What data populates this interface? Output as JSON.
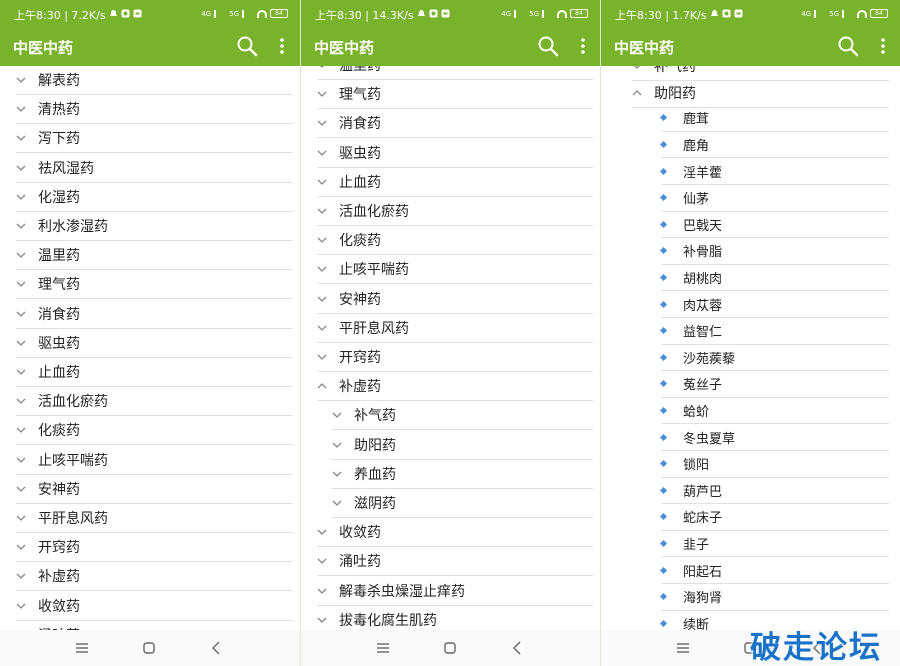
{
  "app_title": "中医中药",
  "watermark": "破走论坛",
  "colors": {
    "primary": "#79b22b",
    "leaf_bullet": "#4a90d9",
    "watermark": "#1a73c9"
  },
  "panels": [
    {
      "status": {
        "time": "上午8:30",
        "speed": "7.2K/s",
        "net1": "4G",
        "net2": "5G",
        "battery": "84"
      },
      "rows": [
        {
          "label": "解表药",
          "level": 0,
          "expanded": false
        },
        {
          "label": "清热药",
          "level": 0,
          "expanded": false
        },
        {
          "label": "泻下药",
          "level": 0,
          "expanded": false
        },
        {
          "label": "祛风湿药",
          "level": 0,
          "expanded": false
        },
        {
          "label": "化湿药",
          "level": 0,
          "expanded": false
        },
        {
          "label": "利水渗湿药",
          "level": 0,
          "expanded": false
        },
        {
          "label": "温里药",
          "level": 0,
          "expanded": false
        },
        {
          "label": "理气药",
          "level": 0,
          "expanded": false
        },
        {
          "label": "消食药",
          "level": 0,
          "expanded": false
        },
        {
          "label": "驱虫药",
          "level": 0,
          "expanded": false
        },
        {
          "label": "止血药",
          "level": 0,
          "expanded": false
        },
        {
          "label": "活血化瘀药",
          "level": 0,
          "expanded": false
        },
        {
          "label": "化痰药",
          "level": 0,
          "expanded": false
        },
        {
          "label": "止咳平喘药",
          "level": 0,
          "expanded": false
        },
        {
          "label": "安神药",
          "level": 0,
          "expanded": false
        },
        {
          "label": "平肝息风药",
          "level": 0,
          "expanded": false
        },
        {
          "label": "开窍药",
          "level": 0,
          "expanded": false
        },
        {
          "label": "补虚药",
          "level": 0,
          "expanded": false
        },
        {
          "label": "收敛药",
          "level": 0,
          "expanded": false
        },
        {
          "label": "涌吐药",
          "level": 0,
          "expanded": false
        }
      ]
    },
    {
      "status": {
        "time": "上午8:30",
        "speed": "14.3K/s",
        "net1": "4G",
        "net2": "5G",
        "battery": "84"
      },
      "rows": [
        {
          "label": "温里药",
          "level": 0,
          "expanded": false
        },
        {
          "label": "理气药",
          "level": 0,
          "expanded": false
        },
        {
          "label": "消食药",
          "level": 0,
          "expanded": false
        },
        {
          "label": "驱虫药",
          "level": 0,
          "expanded": false
        },
        {
          "label": "止血药",
          "level": 0,
          "expanded": false
        },
        {
          "label": "活血化瘀药",
          "level": 0,
          "expanded": false
        },
        {
          "label": "化痰药",
          "level": 0,
          "expanded": false
        },
        {
          "label": "止咳平喘药",
          "level": 0,
          "expanded": false
        },
        {
          "label": "安神药",
          "level": 0,
          "expanded": false
        },
        {
          "label": "平肝息风药",
          "level": 0,
          "expanded": false
        },
        {
          "label": "开窍药",
          "level": 0,
          "expanded": false
        },
        {
          "label": "补虚药",
          "level": 0,
          "expanded": true
        },
        {
          "label": "补气药",
          "level": 1,
          "expanded": false
        },
        {
          "label": "助阳药",
          "level": 1,
          "expanded": false
        },
        {
          "label": "养血药",
          "level": 1,
          "expanded": false
        },
        {
          "label": "滋阴药",
          "level": 1,
          "expanded": false
        },
        {
          "label": "收敛药",
          "level": 0,
          "expanded": false
        },
        {
          "label": "涌吐药",
          "level": 0,
          "expanded": false
        },
        {
          "label": "解毒杀虫燥湿止痒药",
          "level": 0,
          "expanded": false
        },
        {
          "label": "拔毒化腐生肌药",
          "level": 0,
          "expanded": false
        }
      ]
    },
    {
      "status": {
        "time": "上午8:30",
        "speed": "1.7K/s",
        "net1": "4G",
        "net2": "5G",
        "battery": "84"
      },
      "rows": [
        {
          "label": "补气药",
          "level": 1,
          "expanded": false
        },
        {
          "label": "助阳药",
          "level": 1,
          "expanded": true
        },
        {
          "label": "鹿茸",
          "level": 2
        },
        {
          "label": "鹿角",
          "level": 2
        },
        {
          "label": "淫羊藿",
          "level": 2
        },
        {
          "label": "仙茅",
          "level": 2
        },
        {
          "label": "巴戟天",
          "level": 2
        },
        {
          "label": "补骨脂",
          "level": 2
        },
        {
          "label": "胡桃肉",
          "level": 2
        },
        {
          "label": "肉苁蓉",
          "level": 2
        },
        {
          "label": "益智仁",
          "level": 2
        },
        {
          "label": "沙苑蒺藜",
          "level": 2
        },
        {
          "label": "菟丝子",
          "level": 2
        },
        {
          "label": "蛤蚧",
          "level": 2
        },
        {
          "label": "冬虫夏草",
          "level": 2
        },
        {
          "label": "锁阳",
          "level": 2
        },
        {
          "label": "葫芦巴",
          "level": 2
        },
        {
          "label": "蛇床子",
          "level": 2
        },
        {
          "label": "韭子",
          "level": 2
        },
        {
          "label": "阳起石",
          "level": 2
        },
        {
          "label": "海狗肾",
          "level": 2
        },
        {
          "label": "续断",
          "level": 2
        }
      ]
    }
  ]
}
